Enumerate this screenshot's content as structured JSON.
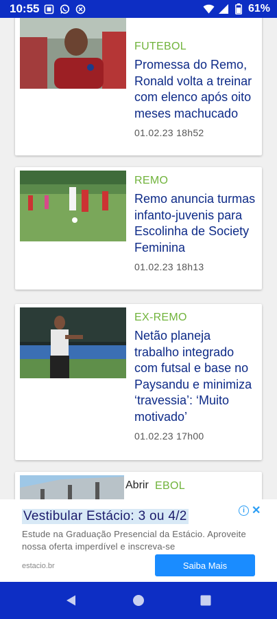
{
  "status_bar": {
    "time": "10:55",
    "battery_text": "61%",
    "icons": [
      "screenshot-icon",
      "whatsapp-icon",
      "cast-icon",
      "wifi-icon",
      "signal-icon",
      "battery-icon"
    ]
  },
  "feed": {
    "articles": [
      {
        "category": "FUTEBOL",
        "headline": "Promessa do Remo, Ronald volta a treinar com elenco após oito meses machucado",
        "date": "01.02.23 18h52"
      },
      {
        "category": "REMO",
        "headline": "Remo anuncia turmas infanto-juvenis para Escolinha de Society Feminina",
        "date": "01.02.23 18h13"
      },
      {
        "category": "EX-REMO",
        "headline": "Netão planeja trabalho integrado com futsal e base no Paysandu e minimiza ‘travessia’: ‘Muito motivado’",
        "date": "01.02.23 17h00"
      },
      {
        "category": "FUTEBOL",
        "category_visible": "EBOL",
        "overlay_label": "Abrir"
      }
    ]
  },
  "ad": {
    "title": "Vestibular Estácio: 3 ou 4/2",
    "description": "Estude na Graduação Presencial da Estácio. Aproveite nossa oferta imperdível e inscreva-se",
    "url": "estacio.br",
    "cta": "Saiba Mais",
    "info_glyph": "i",
    "close_glyph": "✕"
  },
  "colors": {
    "brand_blue": "#0d2ec4",
    "category_green": "#70b33b",
    "headline_navy": "#0d2a87",
    "cta_blue": "#1a8cff"
  }
}
